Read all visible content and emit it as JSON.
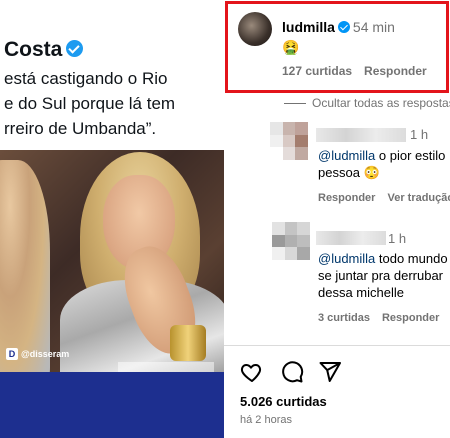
{
  "tweet": {
    "name": "Costa",
    "lines": [
      "está castigando o Rio",
      "e do Sul porque lá tem",
      "rreiro de Umbanda”."
    ]
  },
  "video": {
    "watermark": "@disseram"
  },
  "post": {
    "username": "ludmilla",
    "time": "54 min",
    "emoji": "🤮",
    "likes": "127 curtidas",
    "reply": "Responder"
  },
  "hide_all": "Ocultar todas as respostas",
  "comments": [
    {
      "time": "1 h",
      "mention": "@ludmilla",
      "text_line1": " o pior estilo",
      "text_line2": "pessoa 😳",
      "reply": "Responder",
      "translate": "Ver tradução"
    },
    {
      "time": "1 h",
      "mention": "@ludmilla",
      "text_line1": " todo mundo",
      "text_line2": "se juntar pra derrubar",
      "text_line3": "dessa michelle",
      "likes": "3 curtidas",
      "reply": "Responder"
    }
  ],
  "footer": {
    "likes": "5.026 curtidas",
    "ago": "há 2 horas"
  },
  "colors": {
    "highlight": "#e3141b",
    "verified": "#0095f6",
    "mention": "#00376b",
    "muted": "#737373"
  },
  "icons": [
    "heart-icon",
    "comment-icon",
    "share-icon"
  ]
}
